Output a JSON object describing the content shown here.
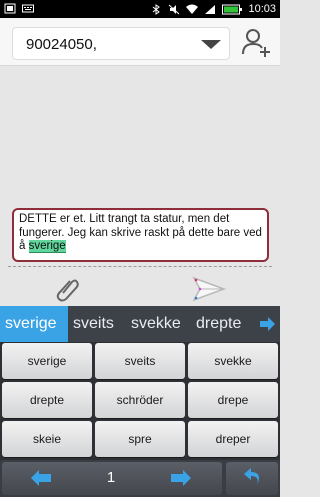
{
  "status_bar": {
    "time": "10:03",
    "icons": [
      "screenshot-icon",
      "keyboard-icon",
      "bluetooth-icon",
      "mute-icon",
      "wifi-icon",
      "signal-icon",
      "battery-icon"
    ]
  },
  "header": {
    "recipient_value": "90024050,"
  },
  "composer": {
    "text_before": "DETTE er et. Litt trangt ta statur,  men det fungerer.          Jeg kan skrive raskt på dette bare ved å ",
    "highlighted_word": "sverige"
  },
  "keyboard": {
    "suggestions": [
      "sverige",
      "sveits",
      "svekke",
      "drepte"
    ],
    "keys": [
      [
        "sverige",
        "sveits",
        "svekke"
      ],
      [
        "drepte",
        "schröder",
        "drepe"
      ],
      [
        "skeie",
        "spre",
        "dreper"
      ]
    ],
    "page_number": "1"
  },
  "colors": {
    "accent": "#3aa3e6",
    "highlight": "#60d59c",
    "composer_border": "#8c2f3a"
  }
}
